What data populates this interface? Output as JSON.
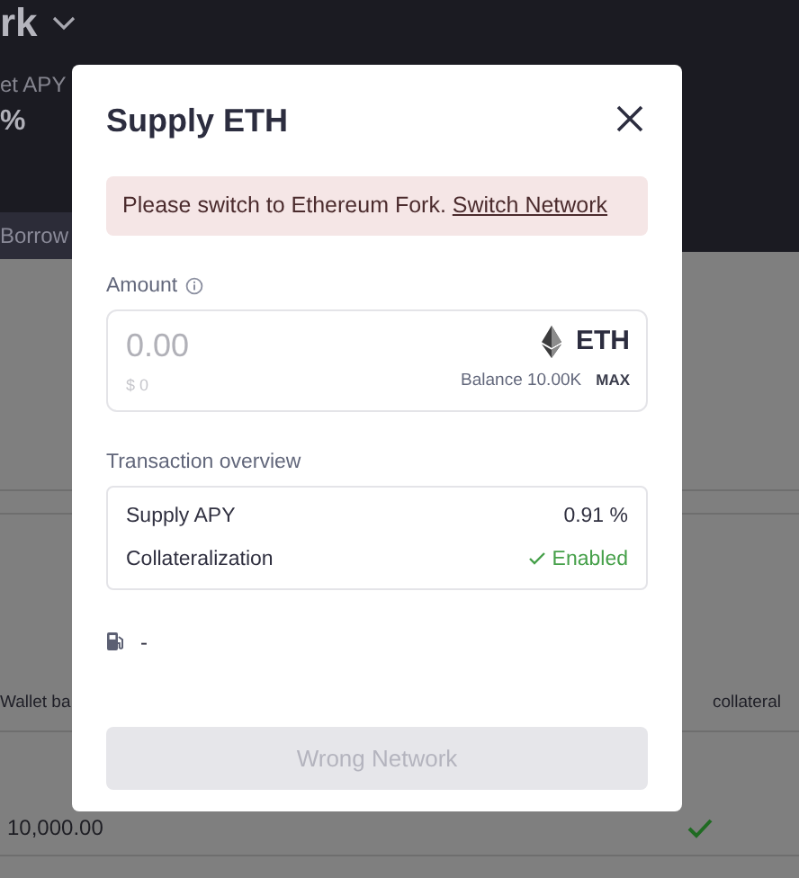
{
  "background": {
    "header_title": "rk",
    "net_apy_label": "et APY",
    "net_apy_value": "%",
    "tab": "Borrow",
    "columns": [
      "Wallet ba",
      "collateral"
    ],
    "row": {
      "wallet_balance": "10,000.00",
      "collateral": true
    }
  },
  "modal": {
    "title": "Supply ETH",
    "alert": {
      "text": "Please switch to Ethereum Fork.",
      "link": "Switch Network"
    },
    "amount": {
      "label": "Amount",
      "placeholder": "0.00",
      "usd": "$ 0",
      "token": "ETH",
      "balance_label": "Balance",
      "balance": "10.00K",
      "max": "MAX"
    },
    "overview": {
      "title": "Transaction overview",
      "rows": [
        {
          "kind": "value",
          "label": "Supply APY",
          "value": "0.91",
          "unit": "%"
        },
        {
          "kind": "status",
          "label": "Collateralization",
          "value": "Enabled",
          "enabled": true
        }
      ]
    },
    "gas": "-",
    "button": {
      "label": "Wrong Network",
      "disabled": true
    }
  }
}
